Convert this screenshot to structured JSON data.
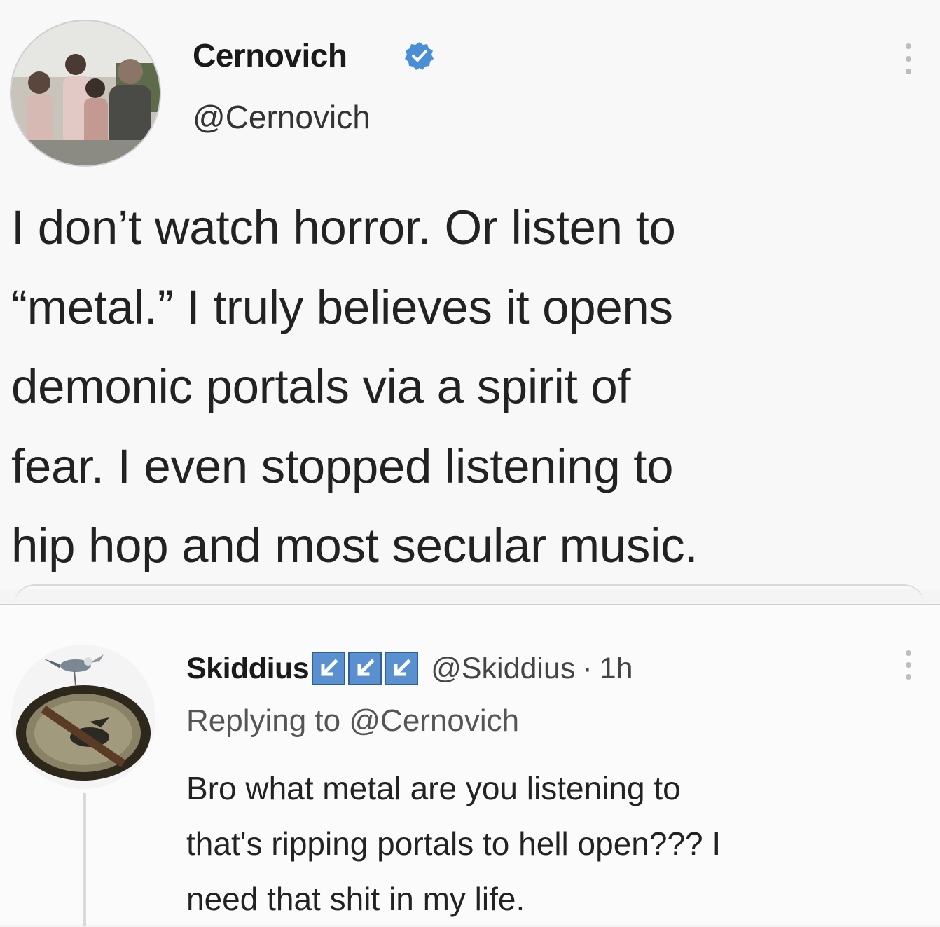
{
  "original_tweet": {
    "display_name": "Cernovich",
    "handle": "@Cernovich",
    "verified_icon": "verified-check-icon",
    "more_icon": "more-options-icon",
    "text_lines": [
      "I don’t watch horror. Or listen to",
      "“metal.” I truly believes it opens",
      "demonic portals via a spirit of",
      "fear. I even stopped listening to",
      "hip hop and most secular music."
    ]
  },
  "reply_tweet": {
    "display_name": "Skiddius",
    "badges": [
      "arrow-badge-icon",
      "arrow-badge-icon",
      "arrow-badge-icon"
    ],
    "handle": "@Skiddius",
    "separator": "·",
    "time": "1h",
    "replying_label": "Replying to",
    "replying_handle": "@Cernovich",
    "text_lines": [
      "Bro what metal are you listening to",
      "that's ripping portals to hell open??? I",
      "need that shit in my life."
    ]
  },
  "colors": {
    "verified_blue": "#4a8fd6",
    "badge_blue": "#5a8fd0",
    "background": "#f8f8f8",
    "text": "#222222"
  }
}
